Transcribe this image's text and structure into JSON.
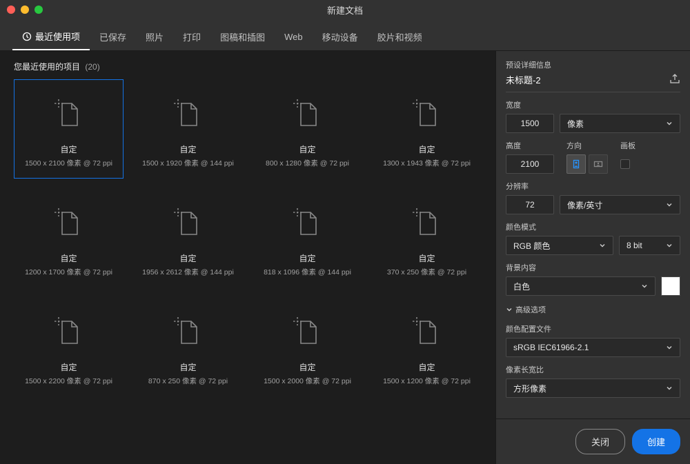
{
  "window_title": "新建文档",
  "tabs": [
    {
      "label": "最近使用项",
      "active": true,
      "has_icon": true
    },
    {
      "label": "已保存"
    },
    {
      "label": "照片"
    },
    {
      "label": "打印"
    },
    {
      "label": "图稿和插图"
    },
    {
      "label": "Web"
    },
    {
      "label": "移动设备"
    },
    {
      "label": "胶片和视频"
    }
  ],
  "recent_header": "您最近使用的项目",
  "recent_count": "(20)",
  "presets": [
    {
      "name": "自定",
      "dims": "1500 x 2100 像素 @ 72 ppi",
      "selected": true
    },
    {
      "name": "自定",
      "dims": "1500 x 1920 像素 @ 144 ppi"
    },
    {
      "name": "自定",
      "dims": "800 x 1280 像素 @ 72 ppi"
    },
    {
      "name": "自定",
      "dims": "1300 x 1943 像素 @ 72 ppi"
    },
    {
      "name": "自定",
      "dims": "1200 x 1700 像素 @ 72 ppi"
    },
    {
      "name": "自定",
      "dims": "1956 x 2612 像素 @ 144 ppi"
    },
    {
      "name": "自定",
      "dims": "818 x 1096 像素 @ 144 ppi"
    },
    {
      "name": "自定",
      "dims": "370 x 250 像素 @ 72 ppi"
    },
    {
      "name": "自定",
      "dims": "1500 x 2200 像素 @ 72 ppi"
    },
    {
      "name": "自定",
      "dims": "870 x 250 像素 @ 72 ppi"
    },
    {
      "name": "自定",
      "dims": "1500 x 2000 像素 @ 72 ppi"
    },
    {
      "name": "自定",
      "dims": "1500 x 1200 像素 @ 72 ppi"
    }
  ],
  "details": {
    "header": "预设详细信息",
    "name_value": "未标题-2",
    "width_label": "宽度",
    "width_value": "1500",
    "width_unit": "像素",
    "height_label": "高度",
    "height_value": "2100",
    "orientation_label": "方向",
    "artboard_label": "画板",
    "resolution_label": "分辨率",
    "resolution_value": "72",
    "resolution_unit": "像素/英寸",
    "color_mode_label": "颜色模式",
    "color_mode_value": "RGB 颜色",
    "bit_depth": "8 bit",
    "background_label": "背景内容",
    "background_value": "白色",
    "advanced_label": "高级选项",
    "profile_label": "颜色配置文件",
    "profile_value": "sRGB IEC61966-2.1",
    "pixel_ratio_label": "像素长宽比",
    "pixel_ratio_value": "方形像素"
  },
  "buttons": {
    "close": "关闭",
    "create": "创建"
  }
}
